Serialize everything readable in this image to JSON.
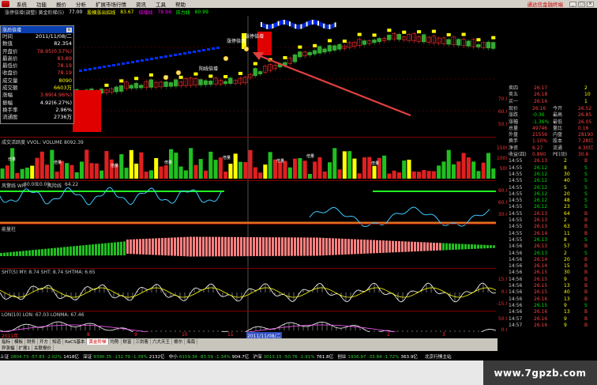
{
  "window": {
    "menu": [
      "系统",
      "功能",
      "报价",
      "分析",
      "扩展市场行情",
      "资讯",
      "工具",
      "帮助"
    ],
    "notice": "通达信金融终端",
    "buttons": [
      "_",
      "□",
      "×"
    ]
  },
  "infobar": {
    "title": "涨停倍增(调整) 黄金阶梯(5)",
    "values": [
      "77.00",
      "股横涨出招线",
      "83.67",
      "倍增线",
      "78.94",
      "压力线",
      "60.99"
    ]
  },
  "popup": {
    "title": "涨后倍增",
    "close": "×",
    "rows": [
      {
        "k": "时间",
        "v": "2011/11/08/二",
        "c": "#ffffff"
      },
      {
        "k": "数值",
        "v": "82.354",
        "c": "#ffffff"
      },
      {
        "k": "开盘价",
        "v": "78.95(0.57%)",
        "c": "#ff4040"
      },
      {
        "k": "最高价",
        "v": "83.89",
        "c": "#ff4040"
      },
      {
        "k": "最低价",
        "v": "78.19",
        "c": "#ff4040"
      },
      {
        "k": "收盘价",
        "v": "78.19",
        "c": "#ff4040"
      },
      {
        "k": "成交量",
        "v": "8090",
        "c": "#ffff00"
      },
      {
        "k": "成交额",
        "v": "6603万",
        "c": "#ffff00"
      },
      {
        "k": "涨幅",
        "v": "3.89(4.96%)",
        "c": "#ff4040"
      },
      {
        "k": "振幅",
        "v": "4.92(6.27%)",
        "c": "#ffffff"
      },
      {
        "k": "换手率",
        "v": "2.96%",
        "c": "#ffffff"
      },
      {
        "k": "流通股",
        "v": "2736万",
        "c": "#ffffff"
      }
    ]
  },
  "main_chart": {
    "labels": [
      "涨停倍增",
      "涨停倍增",
      "阳线倍增"
    ],
    "right_scale": [
      "70.00",
      "60.00",
      "50.00"
    ]
  },
  "volume_panel": {
    "label": "成交活跃度 VVOL: VOLUME 8092.39",
    "labels": [
      "倍量",
      "倍量",
      "倍量",
      "倍量",
      "倍量",
      "倍量",
      "倍量",
      "倍量"
    ],
    "right_scale": [
      "15000",
      "10000",
      "5000"
    ]
  },
  "kdj_panel": {
    "label_a": "风警线 WR:",
    "value_a": "80.00",
    "label_b": "10.00",
    "label_c": "风险线",
    "value_c": "64.22",
    "right_scale": [
      "90.00",
      "60.00",
      "30.00"
    ]
  },
  "energy_panel": {
    "label": "能量柱"
  },
  "sht_panel": {
    "label": "SHT(5) MY: 8.74 SHT: 8.74 SHTMA: 6.65",
    "right_scale": [
      "15.00",
      "0.00",
      "-15.00"
    ]
  },
  "lon_panel": {
    "label": "LON(10) LON: 67.03 LONMA: 67.46",
    "highlight": "LON: 67.03",
    "right_scale": [
      "50.00",
      "0.00"
    ]
  },
  "date_axis": {
    "labels": [
      "2011年",
      "8",
      "9",
      "10",
      "11",
      "2011/11/08/二",
      "2",
      "3"
    ]
  },
  "quote": {
    "top": [
      {
        "k": "卖四",
        "v": "26.17",
        "n": "2",
        "vc": "#ff4040"
      },
      {
        "k": "卖五",
        "v": "26.18",
        "n": "10",
        "vc": "#ff4040"
      },
      {
        "k": "买一",
        "v": "26.16",
        "n": "1",
        "vc": "#ff4040"
      }
    ],
    "summary": [
      {
        "a": "现价",
        "b": "26.16",
        "c": "今开",
        "d": "26.52"
      },
      {
        "a": "涨跌",
        "b": "-0.36",
        "c": "最高",
        "d": "26.85"
      },
      {
        "a": "涨幅",
        "b": "-1.36%",
        "c": "最低",
        "d": "26.05"
      },
      {
        "a": "总量",
        "b": "49746",
        "c": "量比",
        "d": "0.16"
      },
      {
        "a": "外盘",
        "b": "21556",
        "c": "内盘",
        "d": "28190"
      },
      {
        "a": "换手",
        "b": "1.10%",
        "c": "股本",
        "d": "7.28亿"
      },
      {
        "a": "净资",
        "b": "6.27",
        "c": "流通",
        "d": "4.30亿"
      },
      {
        "a": "收益(四)",
        "b": "0.890",
        "c": "PE(动)",
        "d": "30.6"
      }
    ],
    "ticks": [
      {
        "t": "14:55",
        "p": "26.13",
        "n": "2",
        "s": "B"
      },
      {
        "t": "14:55",
        "p": "26.12",
        "n": "8",
        "s": "S"
      },
      {
        "t": "14:55",
        "p": "26.12",
        "n": "30",
        "s": "S"
      },
      {
        "t": "14:55",
        "p": "26.12",
        "n": "40",
        "s": "S"
      },
      {
        "t": "14:55",
        "p": "26.12",
        "n": "5",
        "s": "S"
      },
      {
        "t": "14:55",
        "p": "26.12",
        "n": "20",
        "s": "S"
      },
      {
        "t": "14:55",
        "p": "26.12",
        "n": "48",
        "s": "S"
      },
      {
        "t": "14:55",
        "p": "26.12",
        "n": "23",
        "s": "S"
      },
      {
        "t": "14:55",
        "p": "26.13",
        "n": "64",
        "s": "B"
      },
      {
        "t": "14:55",
        "p": "26.13",
        "n": "2",
        "s": "B"
      },
      {
        "t": "14:55",
        "p": "26.13",
        "n": "63",
        "s": "B"
      },
      {
        "t": "14:55",
        "p": "26.14",
        "n": "11",
        "s": "B"
      },
      {
        "t": "14:55",
        "p": "26.13",
        "n": "8",
        "s": "S"
      },
      {
        "t": "14:56",
        "p": "26.13",
        "n": "57",
        "s": "B"
      },
      {
        "t": "14:56",
        "p": "26.13",
        "n": "2",
        "s": "S"
      },
      {
        "t": "14:56",
        "p": "26.14",
        "n": "20",
        "s": "B"
      },
      {
        "t": "14:56",
        "p": "26.14",
        "n": "15",
        "s": "B"
      },
      {
        "t": "14:56",
        "p": "26.15",
        "n": "30",
        "s": "B"
      },
      {
        "t": "14:56",
        "p": "26.15",
        "n": "9",
        "s": "B"
      },
      {
        "t": "14:56",
        "p": "26.15",
        "n": "13",
        "s": "B"
      },
      {
        "t": "14:56",
        "p": "26.15",
        "n": "40",
        "s": "B"
      },
      {
        "t": "14:56",
        "p": "26.16",
        "n": "13",
        "s": "B"
      },
      {
        "t": "14:56",
        "p": "26.15",
        "n": "9",
        "s": "S"
      },
      {
        "t": "14:56",
        "p": "26.16",
        "n": "13",
        "s": "B"
      },
      {
        "t": "14:57",
        "p": "26.16",
        "n": "9",
        "s": "B"
      },
      {
        "t": "14:57",
        "p": "26.16",
        "n": "9",
        "s": "B"
      }
    ]
  },
  "tabbar": {
    "row1": [
      "指标",
      "模板",
      "财务",
      "开方",
      "知道",
      "RaCS基本",
      "黄金阶梯",
      "均势",
      "财富",
      "三剑客",
      "六大天王",
      "睿尔",
      "海南"
    ],
    "row1_active": 6,
    "row2": [
      "异涨幅",
      "扩展1",
      "关联报价"
    ]
  },
  "status": [
    {
      "label": "上证",
      "val": "2804.73",
      "chg": "-57.83",
      "pct": "-2.02%",
      "amt": "1418亿",
      "color": "gr"
    },
    {
      "label": "深证",
      "val": "9390.35",
      "chg": "-132.79",
      "pct": "-1.39%",
      "amt": "2132亿",
      "color": "gr"
    },
    {
      "label": "中小",
      "val": "6159.34",
      "chg": "-83.59",
      "pct": "-1.34%",
      "amt": "904.7亿",
      "color": "gr"
    },
    {
      "label": "沪深",
      "val": "3013.15",
      "chg": "-50.76",
      "pct": "-1.91%",
      "amt": "761.8亿",
      "color": "gr"
    },
    {
      "label": "创业",
      "val": "1936.97",
      "chg": "-33.84",
      "pct": "-1.72%",
      "amt": "363.9亿",
      "color": "gr"
    }
  ],
  "status_right": "北京行情主站",
  "watermark": "www.7gpzb.com",
  "colors": {
    "up": "#ff3030",
    "down": "#00e000",
    "yellow": "#ffff00",
    "blue": "#0030ff",
    "cyan": "#40c8ff",
    "arrow": "#e04040"
  }
}
